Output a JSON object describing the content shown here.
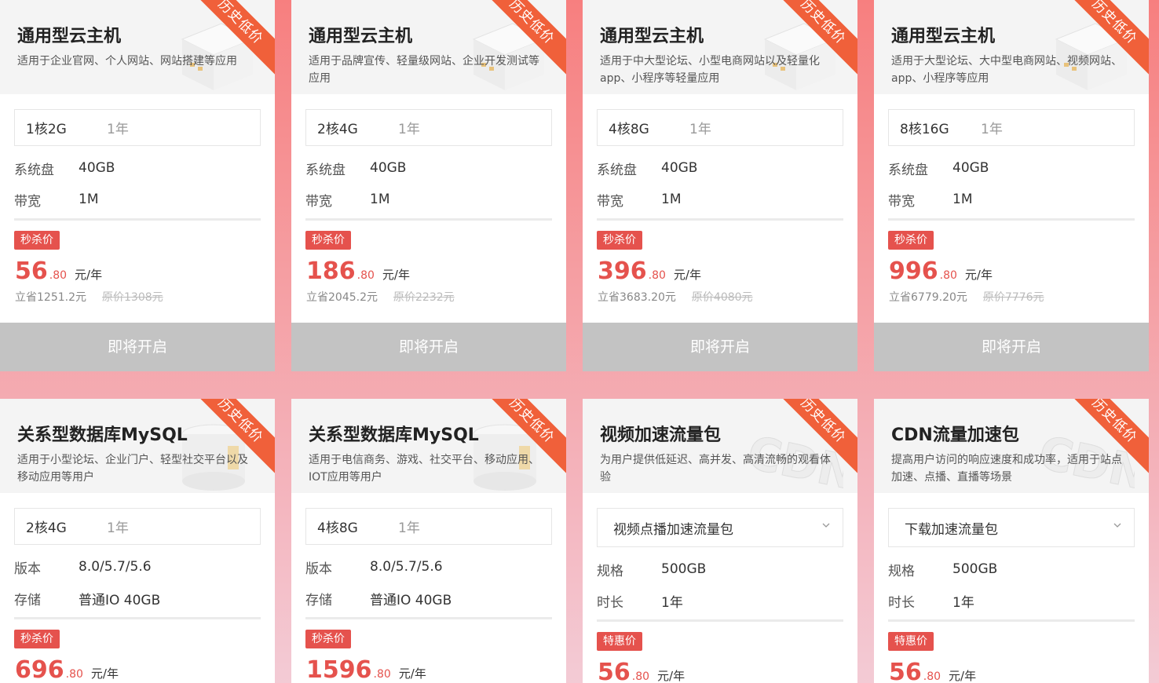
{
  "cards": [
    {
      "ribbon": "历史低价",
      "title": "通用型云主机",
      "desc": "适用于企业官网、个人网站、网站搭建等应用",
      "config": "1核2G",
      "duration": "1年",
      "rows": [
        {
          "k": "系统盘",
          "v": "40GB"
        },
        {
          "k": "带宽",
          "v": "1M"
        }
      ],
      "tag": "秒杀价",
      "price_int": "56",
      "price_dec": ".80",
      "price_unit": "元/年",
      "save": "立省1251.2元",
      "orig": "原价1308元",
      "button": "即将开启"
    },
    {
      "ribbon": "历史低价",
      "title": "通用型云主机",
      "desc": "适用于品牌宣传、轻量级网站、企业开发测试等应用",
      "config": "2核4G",
      "duration": "1年",
      "rows": [
        {
          "k": "系统盘",
          "v": "40GB"
        },
        {
          "k": "带宽",
          "v": "1M"
        }
      ],
      "tag": "秒杀价",
      "price_int": "186",
      "price_dec": ".80",
      "price_unit": "元/年",
      "save": "立省2045.2元",
      "orig": "原价2232元",
      "button": "即将开启"
    },
    {
      "ribbon": "历史低价",
      "title": "通用型云主机",
      "desc": "适用于中大型论坛、小型电商网站以及轻量化app、小程序等轻量应用",
      "config": "4核8G",
      "duration": "1年",
      "rows": [
        {
          "k": "系统盘",
          "v": "40GB"
        },
        {
          "k": "带宽",
          "v": "1M"
        }
      ],
      "tag": "秒杀价",
      "price_int": "396",
      "price_dec": ".80",
      "price_unit": "元/年",
      "save": "立省3683.20元",
      "orig": "原价4080元",
      "button": "即将开启"
    },
    {
      "ribbon": "历史低价",
      "title": "通用型云主机",
      "desc": "适用于大型论坛、大中型电商网站、视频网站、app、小程序等应用",
      "config": "8核16G",
      "duration": "1年",
      "rows": [
        {
          "k": "系统盘",
          "v": "40GB"
        },
        {
          "k": "带宽",
          "v": "1M"
        }
      ],
      "tag": "秒杀价",
      "price_int": "996",
      "price_dec": ".80",
      "price_unit": "元/年",
      "save": "立省6779.20元",
      "orig": "原价7776元",
      "button": "即将开启"
    },
    {
      "ribbon": "历史低价",
      "title": "关系型数据库MySQL",
      "desc": "适用于小型论坛、企业门户、轻型社交平台以及移动应用等用户",
      "config": "2核4G",
      "duration": "1年",
      "rows": [
        {
          "k": "版本",
          "v": "8.0/5.7/5.6"
        },
        {
          "k": "存储",
          "v": "普通IO 40GB"
        }
      ],
      "tag": "秒杀价",
      "price_int": "696",
      "price_dec": ".80",
      "price_unit": "元/年"
    },
    {
      "ribbon": "历史低价",
      "title": "关系型数据库MySQL",
      "desc": "适用于电信商务、游戏、社交平台、移动应用、IOT应用等用户",
      "config": "4核8G",
      "duration": "1年",
      "rows": [
        {
          "k": "版本",
          "v": "8.0/5.7/5.6"
        },
        {
          "k": "存储",
          "v": "普通IO 40GB"
        }
      ],
      "tag": "秒杀价",
      "price_int": "1596",
      "price_dec": ".80",
      "price_unit": "元/年"
    },
    {
      "ribbon": "历史低价",
      "title": "视频加速流量包",
      "desc": "为用户提供低延迟、高并发、高清流畅的观看体验",
      "select": "视频点播加速流量包",
      "rows": [
        {
          "k": "规格",
          "v": "500GB"
        },
        {
          "k": "时长",
          "v": "1年"
        }
      ],
      "tag": "特惠价",
      "price_int": "56",
      "price_dec": ".80",
      "price_unit": "元/年"
    },
    {
      "ribbon": "历史低价",
      "title": "CDN流量加速包",
      "desc": "提高用户访问的响应速度和成功率，适用于站点加速、点播、直播等场景",
      "select": "下载加速流量包",
      "rows": [
        {
          "k": "规格",
          "v": "500GB"
        },
        {
          "k": "时长",
          "v": "1年"
        }
      ],
      "tag": "特惠价",
      "price_int": "56",
      "price_dec": ".80",
      "price_unit": "元/年"
    }
  ],
  "art": {
    "watermark": "CDN"
  }
}
